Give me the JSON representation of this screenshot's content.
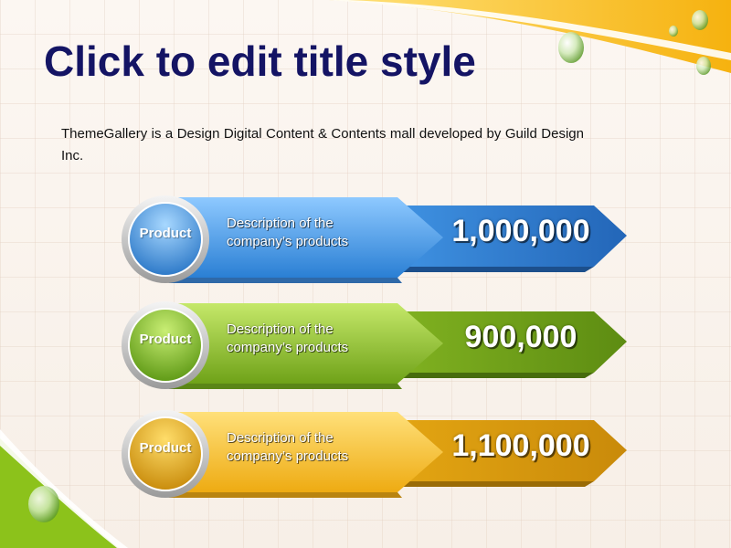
{
  "title": "Click to edit title style",
  "intro": "ThemeGallery is a Design Digital Content & Contents mall developed by Guild Design Inc.",
  "rows": [
    {
      "badge": "Product",
      "description_line1": "Description of the",
      "description_line2": "company’s products",
      "value": "1,000,000",
      "color": "#4da3ee"
    },
    {
      "badge": "Product",
      "description_line1": "Description of the",
      "description_line2": "company’s products",
      "value": "900,000",
      "color": "#8cbf2a"
    },
    {
      "badge": "Product",
      "description_line1": "Description of the",
      "description_line2": "company’s products",
      "value": "1,100,000",
      "color": "#f2b51d"
    }
  ],
  "theme": {
    "corner_accent_yellow": "#f6b20f",
    "corner_accent_green": "#8cc21b"
  }
}
